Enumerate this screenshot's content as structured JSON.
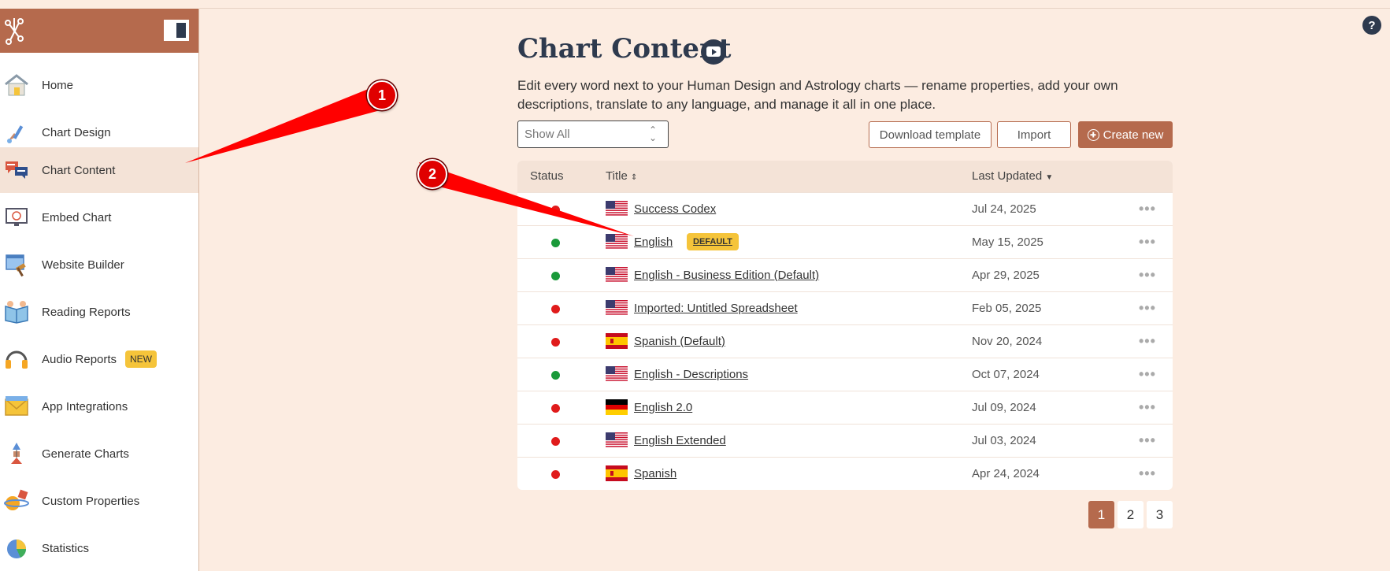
{
  "sidebar": {
    "items": [
      {
        "label": "Home"
      },
      {
        "label": "Chart Design"
      },
      {
        "label": "Chart Content"
      },
      {
        "label": "Embed Chart"
      },
      {
        "label": "Website Builder"
      },
      {
        "label": "Reading Reports"
      },
      {
        "label": "Audio Reports",
        "badge": "NEW"
      },
      {
        "label": "App Integrations"
      },
      {
        "label": "Generate Charts"
      },
      {
        "label": "Custom Properties"
      },
      {
        "label": "Statistics"
      }
    ]
  },
  "help": "?",
  "header": {
    "title": "Chart Content",
    "subtitle": "Edit every word next to your Human Design and Astrology charts — rename properties, add your own descriptions, translate to any language, and manage it all in one place."
  },
  "toolbar": {
    "filter_value": "Show All",
    "download_label": "Download template",
    "import_label": "Import",
    "create_label": "Create new"
  },
  "table": {
    "columns": {
      "status": "Status",
      "title": "Title",
      "updated": "Last Updated"
    },
    "default_badge": "DEFAULT",
    "rows": [
      {
        "status": "red",
        "flag": "us",
        "title": "Success Codex",
        "date": "Jul 24, 2025"
      },
      {
        "status": "green",
        "flag": "us",
        "title": "English",
        "date": "May 15, 2025",
        "default": true
      },
      {
        "status": "green",
        "flag": "us",
        "title": "English - Business Edition (Default)",
        "date": "Apr 29, 2025"
      },
      {
        "status": "red",
        "flag": "us",
        "title": "Imported: Untitled Spreadsheet",
        "date": "Feb 05, 2025"
      },
      {
        "status": "red",
        "flag": "es",
        "title": "Spanish (Default)",
        "date": "Nov 20, 2024"
      },
      {
        "status": "green",
        "flag": "us",
        "title": "English - Descriptions",
        "date": "Oct 07, 2024"
      },
      {
        "status": "red",
        "flag": "de",
        "title": "English 2.0",
        "date": "Jul 09, 2024"
      },
      {
        "status": "red",
        "flag": "us",
        "title": "English Extended",
        "date": "Jul 03, 2024"
      },
      {
        "status": "red",
        "flag": "es",
        "title": "Spanish",
        "date": "Apr 24, 2024"
      }
    ]
  },
  "pagination": {
    "pages": [
      "1",
      "2",
      "3"
    ],
    "current": "1"
  },
  "annotations": {
    "marker1": "1",
    "marker2": "2"
  },
  "colors": {
    "accent": "#b56a4d",
    "status_green": "#1a9a3a",
    "status_red": "#e01b1b"
  }
}
